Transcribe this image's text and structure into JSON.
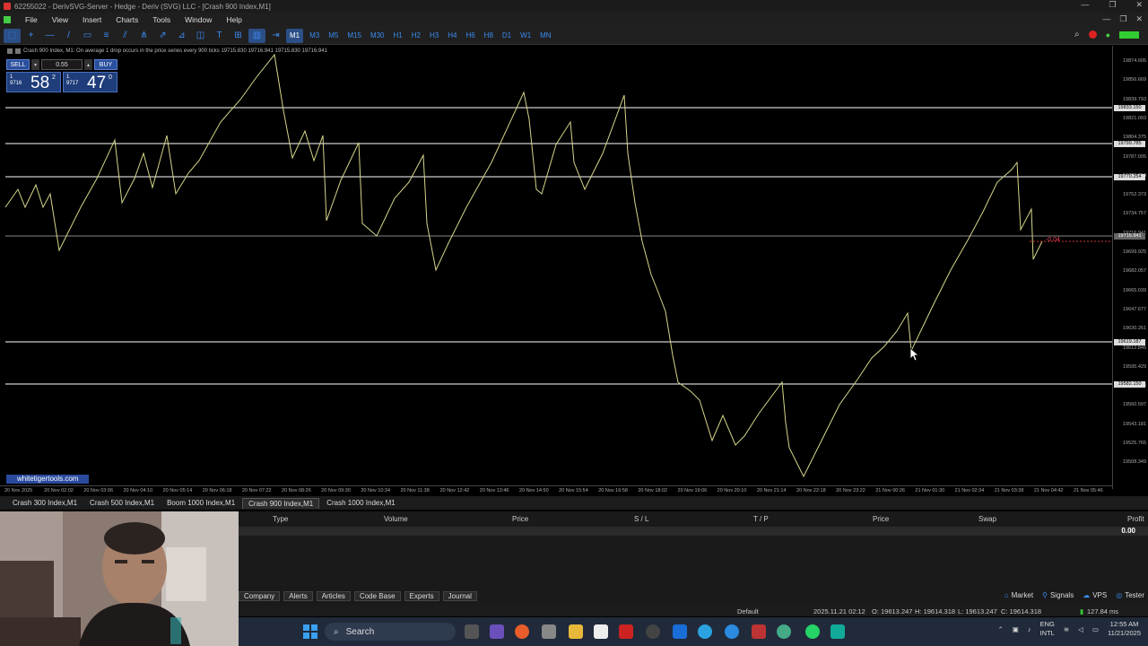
{
  "window": {
    "title": "62255022 - DerivSVG-Server - Hedge - Deriv (SVG) LLC - [Crash 900 Index,M1]",
    "controls": [
      "—",
      "❐",
      "✕"
    ]
  },
  "menu": {
    "items": [
      "File",
      "View",
      "Insert",
      "Charts",
      "Tools",
      "Window",
      "Help"
    ]
  },
  "toolbar": {
    "timeframes": [
      "M1",
      "M3",
      "M5",
      "M15",
      "M30",
      "H1",
      "H2",
      "H3",
      "H4",
      "H6",
      "H8",
      "D1",
      "W1",
      "MN"
    ],
    "active_timeframe": "M1",
    "tools": [
      "cursor-icon",
      "crosshair-icon",
      "hline-icon",
      "trendline-icon",
      "rectangle-icon",
      "fibo-icon",
      "channel-icon",
      "pitchfork-icon",
      "arrows-icon",
      "gann-icon",
      "cycle-icon",
      "text-icon",
      "grid-icon",
      "candles-icon",
      "autoscroll-icon"
    ]
  },
  "chart": {
    "info": "Crash 900 Index, M1:  On average 1 drop occurs in the price series every 900 ticks  19715.830 19716.941 19715.830 19716.941",
    "one_click": {
      "sell_label": "SELL",
      "buy_label": "BUY",
      "volume": "0.55",
      "sell_small": "1",
      "sell_prefix": "9716",
      "sell_big": "58",
      "sell_sup": "2",
      "buy_small": "1",
      "buy_prefix": "9717",
      "buy_big": "47",
      "buy_sup": "0"
    },
    "watermark": "whitetigertools.com",
    "profit_tag": "-0.04",
    "price_labels": [
      "19874.605",
      "19856.669",
      "19839.793",
      "19821.093",
      "19804.375",
      "19787.005",
      "19770.254",
      "19752.373",
      "19734.757",
      "19716.941",
      "19699.925",
      "19682.057",
      "19665.039",
      "19647.677",
      "19630.261",
      "19612.845",
      "19595.429",
      "19578.013",
      "19560.597",
      "19543.181",
      "19525.765",
      "19508.349"
    ],
    "price_badges": [
      "19833.150",
      "19799.785",
      "19770.254",
      "19716.941",
      "19619.187",
      "19582.150"
    ],
    "time_labels": [
      "20 Nov 2025",
      "20 Nov 02:02",
      "20 Nov 03:06",
      "20 Nov 04:10",
      "20 Nov 05:14",
      "20 Nov 06:18",
      "20 Nov 07:22",
      "20 Nov 08:26",
      "20 Nov 09:30",
      "20 Nov 10:34",
      "20 Nov 11:38",
      "20 Nov 12:42",
      "20 Nov 13:46",
      "20 Nov 14:50",
      "20 Nov 15:54",
      "20 Nov 16:58",
      "20 Nov 18:02",
      "20 Nov 19:06",
      "20 Nov 20:10",
      "20 Nov 21:14",
      "20 Nov 22:18",
      "20 Nov 23:22",
      "21 Nov 00:26",
      "21 Nov 01:30",
      "21 Nov 02:34",
      "21 Nov 03:38",
      "21 Nov 04:42",
      "21 Nov 05:46"
    ]
  },
  "chart_tabs": [
    "Crash 300 Index,M1",
    "Crash 500 Index,M1",
    "Boom 1000 Index,M1",
    "Crash 900 Index,M1",
    "Crash 1000 Index,M1"
  ],
  "active_chart_tab": "Crash 900 Index,M1",
  "terminal": {
    "columns": [
      "Type",
      "Volume",
      "Price",
      "S / L",
      "T / P",
      "Price",
      "Swap",
      "Profit"
    ],
    "balance_value": "0.00",
    "tabs": [
      "Company",
      "Alerts",
      "Articles",
      "Code Base",
      "Experts",
      "Journal"
    ],
    "right_tabs": [
      "Market",
      "Signals",
      "VPS",
      "Tester"
    ]
  },
  "status": {
    "profile": "Default",
    "datetime": "2025.11.21 02:12",
    "open": "O: 19613.247",
    "high": "H: 19614.318",
    "low": "L: 19613.247",
    "close": "C: 19614.318",
    "ping": "127.84 ms"
  },
  "taskbar": {
    "search_label": "Search",
    "lang_top": "ENG",
    "lang_bottom": "INTL",
    "time": "12:55 AM",
    "date": "11/21/2025"
  }
}
